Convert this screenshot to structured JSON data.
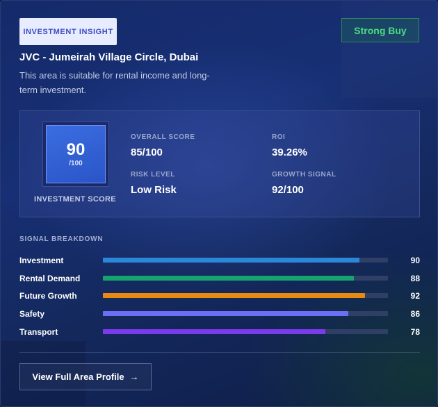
{
  "header": {
    "badge": "INVESTMENT INSIGHT",
    "recommendation": "Strong Buy",
    "title": "JVC - Jumeirah Village Circle, Dubai",
    "description": "This area is suitable for rental income and long-term investment."
  },
  "score": {
    "value": "90",
    "denominator": "/100",
    "label": "INVESTMENT SCORE"
  },
  "stats": {
    "overall": {
      "label": "OVERALL SCORE",
      "value": "85/100"
    },
    "roi": {
      "label": "ROI",
      "value": "39.26%"
    },
    "risk": {
      "label": "RISK LEVEL",
      "value": "Low Risk"
    },
    "growth": {
      "label": "GROWTH SIGNAL",
      "value": "92/100"
    }
  },
  "signals": {
    "title": "SIGNAL BREAKDOWN",
    "items": [
      {
        "name": "Investment",
        "value": 90,
        "color": "#2b87d8"
      },
      {
        "name": "Rental Demand",
        "value": 88,
        "color": "#16a36d"
      },
      {
        "name": "Future Growth",
        "value": 92,
        "color": "#e68a12"
      },
      {
        "name": "Safety",
        "value": 86,
        "color": "#6c6ff5"
      },
      {
        "name": "Transport",
        "value": 78,
        "color": "#7c3aed"
      }
    ]
  },
  "cta": {
    "label": "View Full Area Profile",
    "icon": "arrow-right-icon",
    "arrow": "→"
  },
  "colors": {
    "accent": "#3b6de0",
    "success": "#4ade80"
  }
}
